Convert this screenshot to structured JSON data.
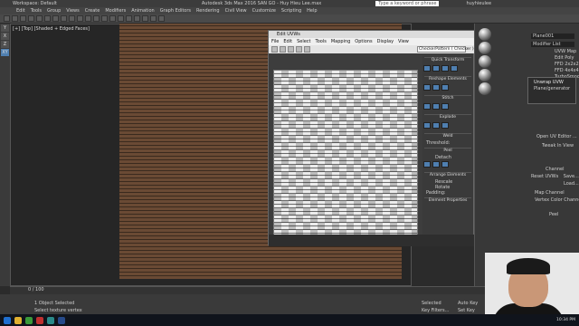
{
  "app": {
    "window_title": "Autodesk 3ds Max 2016   SAN GO - Huy Hieu Lee.max",
    "workspace": "Workspace: Default",
    "search_placeholder": "Type a keyword or phrase",
    "user": "huyhieulee"
  },
  "menu": [
    "Edit",
    "Tools",
    "Group",
    "Views",
    "Create",
    "Modifiers",
    "Animation",
    "Graph Editors",
    "Rendering",
    "Civil View",
    "Customize",
    "Scripting",
    "Help"
  ],
  "viewport": {
    "label": "[+] [Top] [Shaded + Edged Faces]"
  },
  "left_strip": [
    "Y",
    "X",
    "Z",
    "XY"
  ],
  "uvw_editor": {
    "title": "Edit UVWs",
    "menu": [
      "File",
      "Edit",
      "Select",
      "Tools",
      "Mapping",
      "Options",
      "Display",
      "View"
    ],
    "pattern": "CheckerPattern ( Checker )",
    "sections": [
      "Quick Transform",
      "Reshape Elements",
      "Stitch",
      "Explode",
      "Weld",
      "Peel",
      "Detach",
      "Arrange Elements",
      "Element Properties"
    ],
    "labels": [
      "Threshold:",
      "Rescale",
      "Rotate",
      "Padding:"
    ]
  },
  "right_panel": {
    "object": "Plane001",
    "modifier_list": "Modifier List",
    "stack": [
      "Unwrap UVW",
      "Plane/generator"
    ],
    "buttons": [
      "UVW Map",
      "Edit Poly",
      "FFD 2x2x2",
      "FFD 4x4x4",
      "TurboSmooth"
    ],
    "channel": "Channel",
    "map_channel": "Map Channel",
    "vertex_color": "Vertex Color Channel",
    "reset": "Reset UVWs",
    "save": "Save...",
    "load": "Load...",
    "open_editor": "Open UV Editor ...",
    "tweak": "Tweak In View",
    "peel": "Peel"
  },
  "status": {
    "selected": "1 Object Selected",
    "hint": "Select texture vertex",
    "frame": "0 / 100",
    "autokey": "Auto Key",
    "selected_set": "Selected",
    "setkey": "Set Key",
    "keyfilters": "Key Filters..."
  },
  "taskbar": {
    "clock": "10:34 PM"
  },
  "colors": {
    "brick": "#6a4a34",
    "accent_blue": "#4f7fb0",
    "viewport_bg": "#262626"
  }
}
